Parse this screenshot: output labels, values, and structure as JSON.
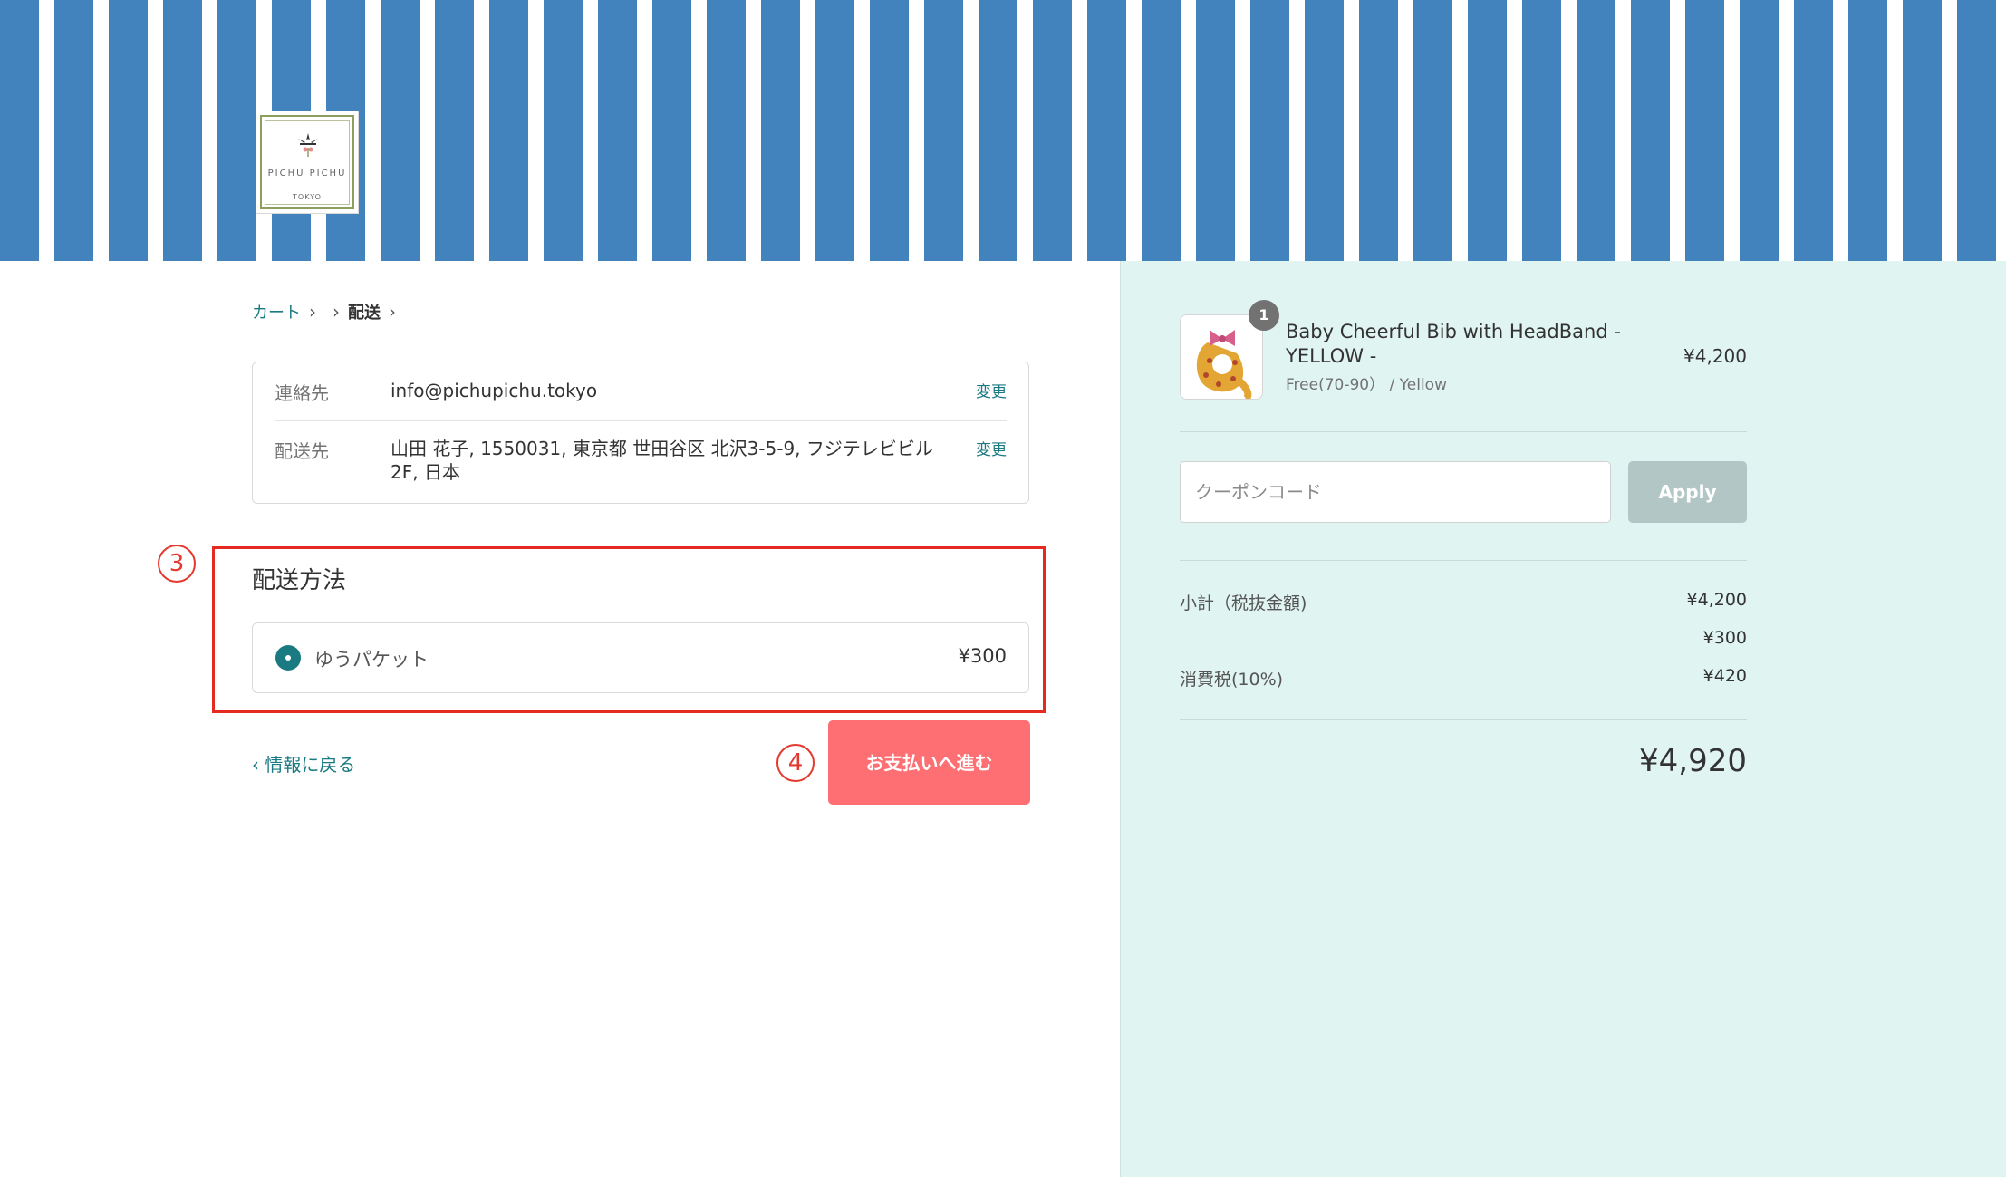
{
  "header": {
    "logo": {
      "brand": "PICHU PICHU",
      "city": "TOKYO"
    }
  },
  "breadcrumb": {
    "items": [
      {
        "label": "カート",
        "current": false
      },
      {
        "label": "",
        "current": false
      },
      {
        "label": "配送",
        "current": true
      }
    ]
  },
  "review": {
    "contact": {
      "label": "連絡先",
      "value": "info@pichupichu.tokyo",
      "change": "変更"
    },
    "address": {
      "label": "配送先",
      "value": "山田 花子, 1550031, 東京都 世田谷区 北沢3-5-9, フジテレビビル 2F, 日本",
      "change": "変更"
    }
  },
  "shipping": {
    "heading": "配送方法",
    "option": {
      "name": "ゆうパケット",
      "price": "¥300",
      "selected": true
    }
  },
  "nav": {
    "back": "情報に戻る",
    "continue": "お支払いへ進む"
  },
  "annotations": {
    "three": "3",
    "four": "4"
  },
  "order": {
    "product": {
      "quantity": "1",
      "name": "Baby Cheerful Bib with HeadBand - YELLOW -",
      "variant": "Free(70-90） / Yellow",
      "price": "¥4,200"
    },
    "coupon": {
      "placeholder": "クーポンコード",
      "apply": "Apply"
    },
    "summary": {
      "subtotal_label": "小計（税抜金額)",
      "subtotal": "¥4,200",
      "shipping_label": "",
      "shipping": "¥300",
      "tax_label": "消費税(10%)",
      "tax": "¥420",
      "total": "¥4,920"
    }
  },
  "colors": {
    "accent": "#1a7a82",
    "stripe_blue": "#4283be",
    "sidebar_bg": "#e0f4f1",
    "pay_button": "#fd6f72",
    "annotation_red": "#e52a22"
  }
}
